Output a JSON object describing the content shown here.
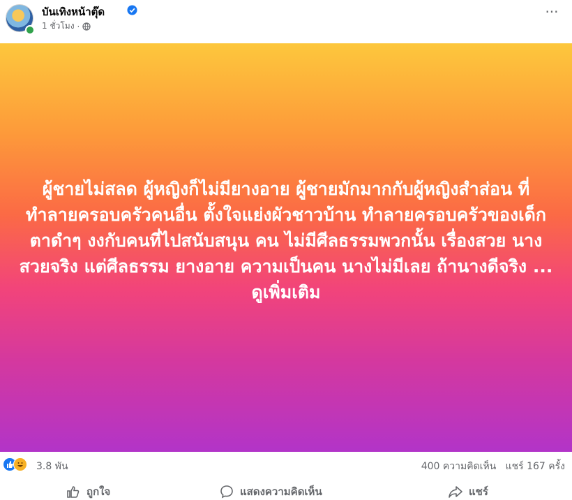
{
  "post": {
    "page_name": "บันเทิงหน้าตุ๊ด",
    "time": "1 ชั่วโมง",
    "separator": "·",
    "more_label": "···",
    "text": "ผู้ชายไม่สลด ผู้หญิงก็ไม่มียางอาย ผู้ชายมักมากกับผู้หญิงสำส่อน ที่ทำลายครอบครัวคนอื่น ตั้งใจแย่งผัวชาวบ้าน ทำลายครอบครัวของเด็กตาดำๆ งงกับคนที่ไปสนับสนุน คน ไม่มีศีลธรรมพวกนั้น เรื่องสวย นางสวยจริง แต่ศีลธรรม ยางอาย ความเป็นคน นางไม่มีเลย ถ้านางดีจริง ... ดูเพิ่มเติม",
    "banner_colors": [
      "#fdc73c",
      "#fb6a45",
      "#b234c8"
    ]
  },
  "stats": {
    "reactions": "3.8 พัน",
    "comments": "400 ความคิดเห็น",
    "shares": "แชร์ 167 ครั้ง"
  },
  "actions": {
    "like": "ถูกใจ",
    "comment": "แสดงความคิดเห็น",
    "share": "แชร์"
  },
  "icons": {
    "verified": "verified-badge-icon",
    "privacy": "globe-icon",
    "like": "thumbs-up-icon",
    "haha": "haha-icon",
    "comment": "comment-bubble-icon",
    "share": "share-arrow-icon"
  }
}
